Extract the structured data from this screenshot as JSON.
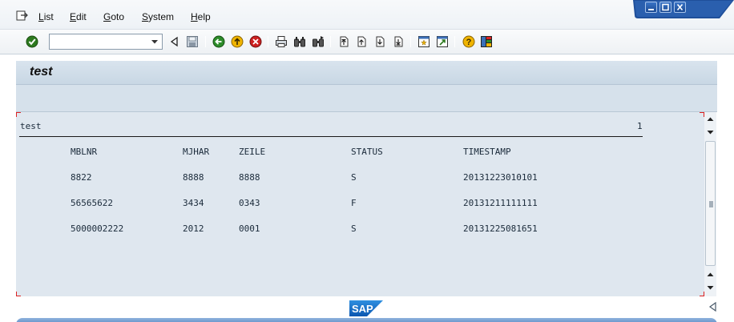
{
  "menu": {
    "items": [
      {
        "label": "List"
      },
      {
        "label": "Edit"
      },
      {
        "label": "Goto"
      },
      {
        "label": "System"
      },
      {
        "label": "Help"
      }
    ]
  },
  "toolbar": {
    "command_field_value": "",
    "icons": [
      "enter-icon",
      "back-nav-icon",
      "save-icon",
      "back-icon",
      "exit-icon",
      "cancel-icon",
      "print-icon",
      "find-icon",
      "find-next-icon",
      "first-page-icon",
      "previous-page-icon",
      "next-page-icon",
      "last-page-icon",
      "create-session-icon",
      "shortcut-icon",
      "help-icon",
      "customize-layout-icon"
    ]
  },
  "screen": {
    "title": "test"
  },
  "list": {
    "header_title": "test",
    "page_number": "1",
    "columns": [
      "MBLNR",
      "MJHAR",
      "ZEILE",
      "STATUS",
      "TIMESTAMP"
    ],
    "rows": [
      [
        "8822",
        "8888",
        "8888",
        "S",
        "20131223010101"
      ],
      [
        "56565622",
        "3434",
        "0343",
        "F",
        "20131211111111"
      ],
      [
        "5000002222",
        "2012",
        "0001",
        "S",
        "20131225081651"
      ]
    ]
  },
  "footer": {
    "logo_text": "SAP"
  },
  "colors": {
    "list_background": "#dfe7ef",
    "title_bar": "#d9e4ee",
    "window_control": "#1f4f9a",
    "status_bar": "#5c8bc6"
  }
}
